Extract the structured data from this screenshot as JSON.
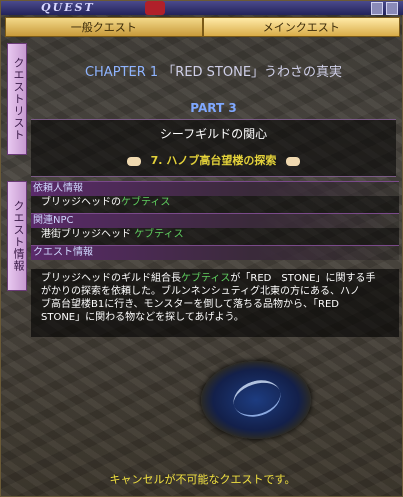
{
  "window": {
    "title": "QUEST"
  },
  "tabs": [
    {
      "label": "一般クエスト"
    },
    {
      "label": "メインクエスト"
    }
  ],
  "side_tabs": {
    "list": "クエストリスト",
    "info": "クエスト情報"
  },
  "chapter": {
    "number": "CHAPTER 1",
    "title": "「RED STONE」うわさの真実"
  },
  "part": "PART 3",
  "subtitle": "シーフギルドの関心",
  "quest": {
    "name": "7. ハノブ高台望楼の探索"
  },
  "client": {
    "header": "依頼人情報",
    "prefix": "ブリッジヘッドの",
    "name": "ケブティス"
  },
  "npc": {
    "header": "関連NPC",
    "prefix": "港街ブリッジヘッド ",
    "name": "ケブティス"
  },
  "details": {
    "header": "クエスト情報",
    "line1a": "ブリッジヘッドのギルド組合長",
    "line1b": "ケブティス",
    "line1c": "が「RED　STONE」に関する手",
    "line2": "がかりの探索を依頼した。ブルンネンシュティグ北東の方にある、ハノ",
    "line3": "ブ高台望楼B1に行き、モンスターを倒して落ちる品物から、「RED",
    "line4": "STONE」に関わる物などを探してあげよう。"
  },
  "footer": "キャンセルが不可能なクエストです。",
  "colors": {
    "npc_name": "#5fd05f",
    "quest_name": "#e4d23a",
    "part": "#7fa8ff",
    "footer": "#f0e040"
  }
}
